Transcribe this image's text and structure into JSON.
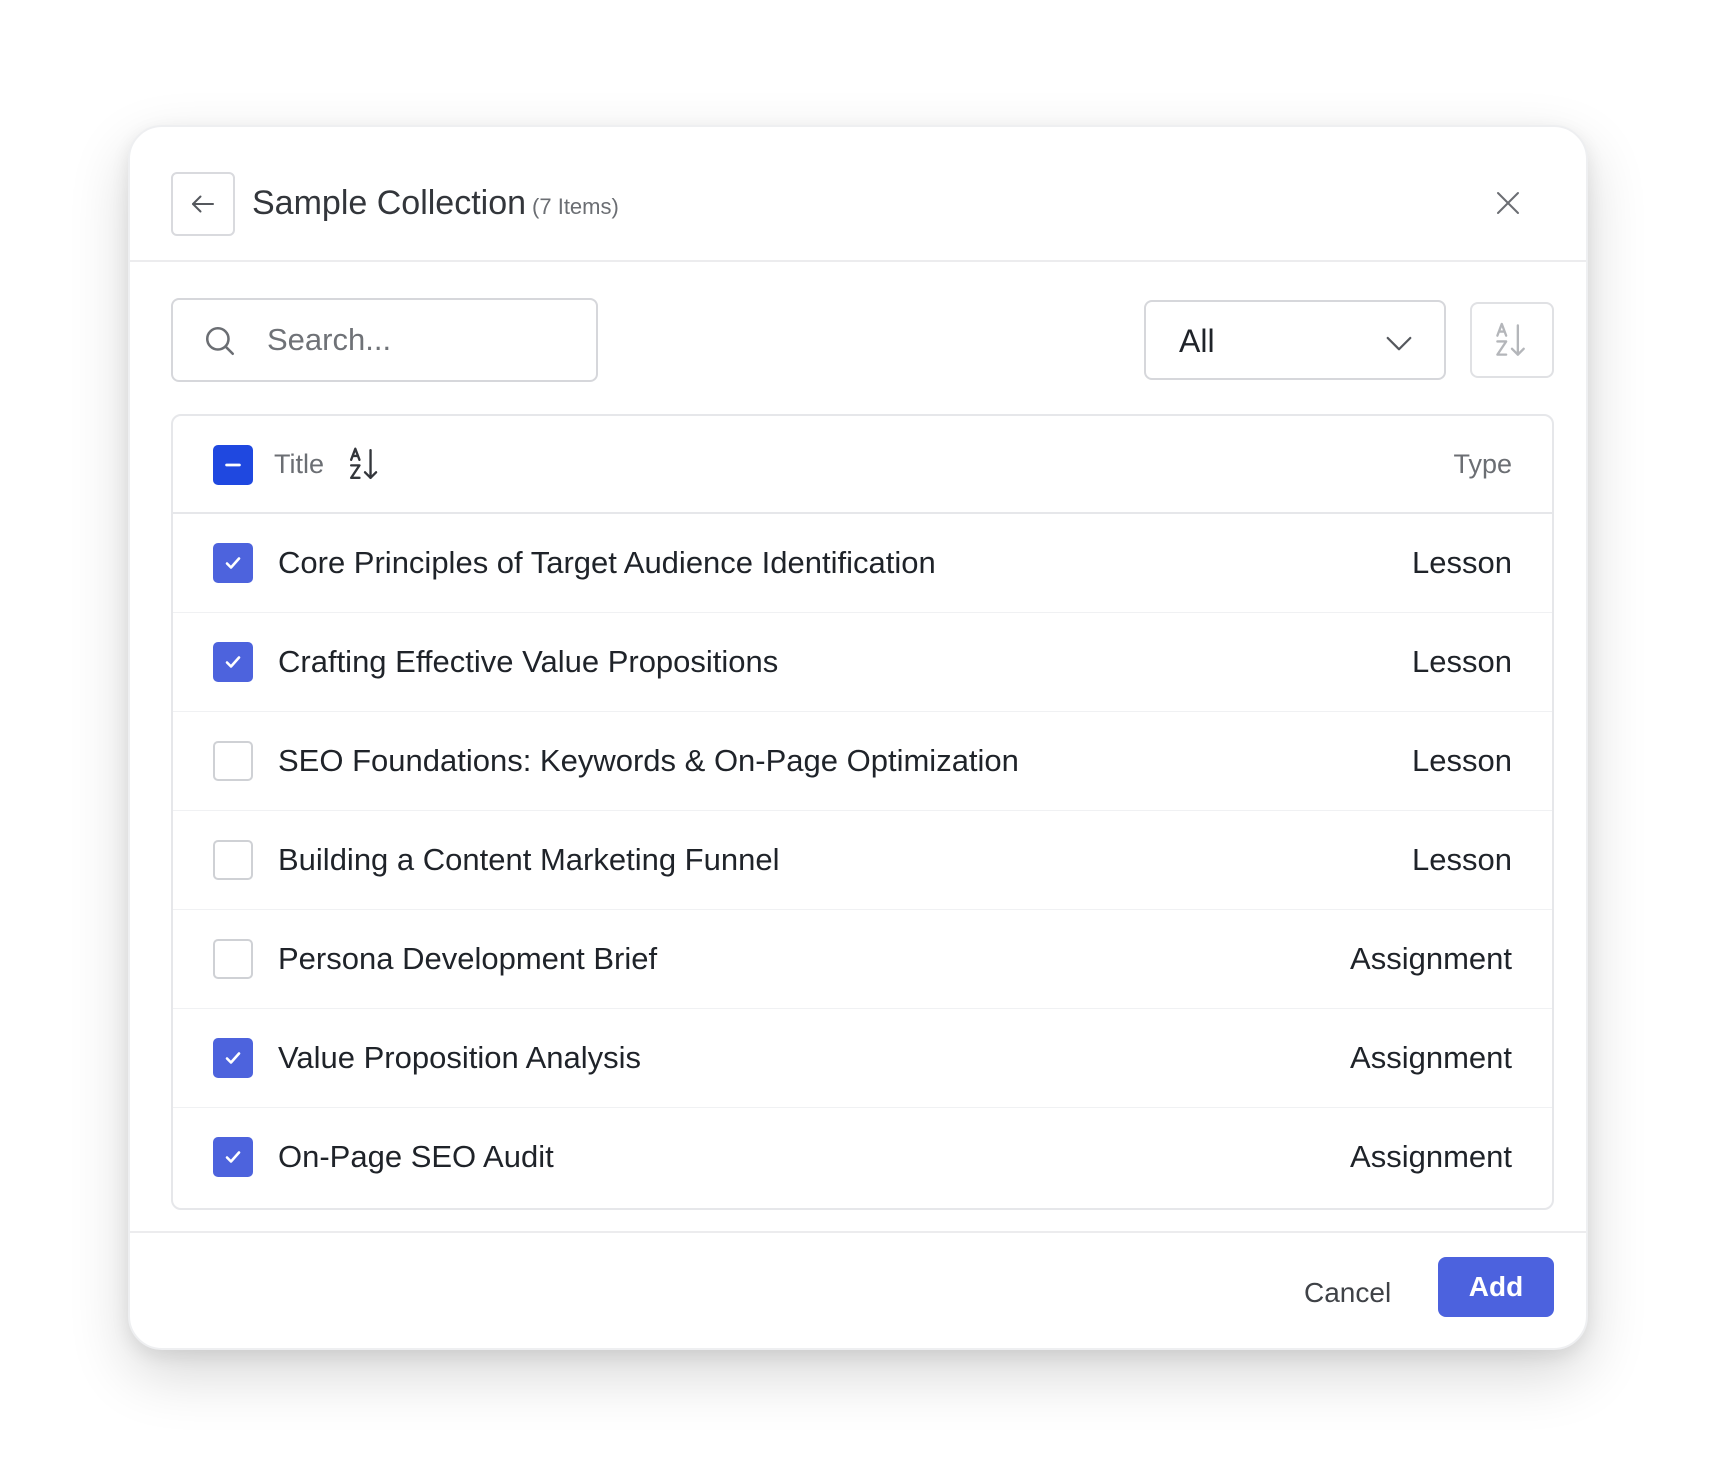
{
  "header": {
    "title": "Sample Collection",
    "count": "(7 Items)"
  },
  "search": {
    "placeholder": "Search..."
  },
  "filter": {
    "selected": "All"
  },
  "table": {
    "columns": {
      "title": "Title",
      "type": "Type"
    },
    "rows": [
      {
        "title": "Core Principles of Target Audience Identification",
        "type": "Lesson",
        "checked": true
      },
      {
        "title": "Crafting Effective Value Propositions",
        "type": "Lesson",
        "checked": true
      },
      {
        "title": "SEO Foundations: Keywords & On-Page Optimization",
        "type": "Lesson",
        "checked": false
      },
      {
        "title": "Building a Content Marketing Funnel",
        "type": "Lesson",
        "checked": false
      },
      {
        "title": "Persona Development Brief",
        "type": "Assignment",
        "checked": false
      },
      {
        "title": "Value Proposition Analysis",
        "type": "Assignment",
        "checked": true
      },
      {
        "title": "On-Page SEO Audit",
        "type": "Assignment",
        "checked": true
      }
    ]
  },
  "footer": {
    "cancel_label": "Cancel",
    "add_label": "Add"
  },
  "colors": {
    "accent": "#4c62de",
    "select_all_partial": "#1f48e0"
  },
  "icons": {
    "back": "arrow-left-icon",
    "close": "close-icon",
    "search": "search-icon",
    "dropdown": "chevron-down-icon",
    "sort": "sort-az-icon"
  }
}
